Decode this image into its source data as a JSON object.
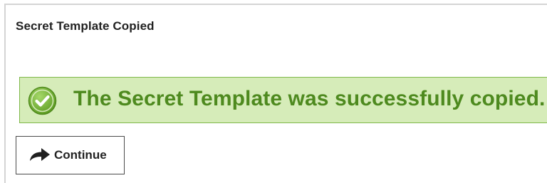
{
  "header": {
    "title": "Secret Template Copied"
  },
  "alert": {
    "type": "success",
    "message": "The Secret Template was successfully copied.",
    "icon": "check-circle-icon",
    "colors": {
      "background": "#d6ecb9",
      "border": "#7fb84a",
      "text": "#4e8a1f"
    }
  },
  "actions": {
    "continue_label": "Continue",
    "continue_icon": "share-arrow-icon"
  }
}
